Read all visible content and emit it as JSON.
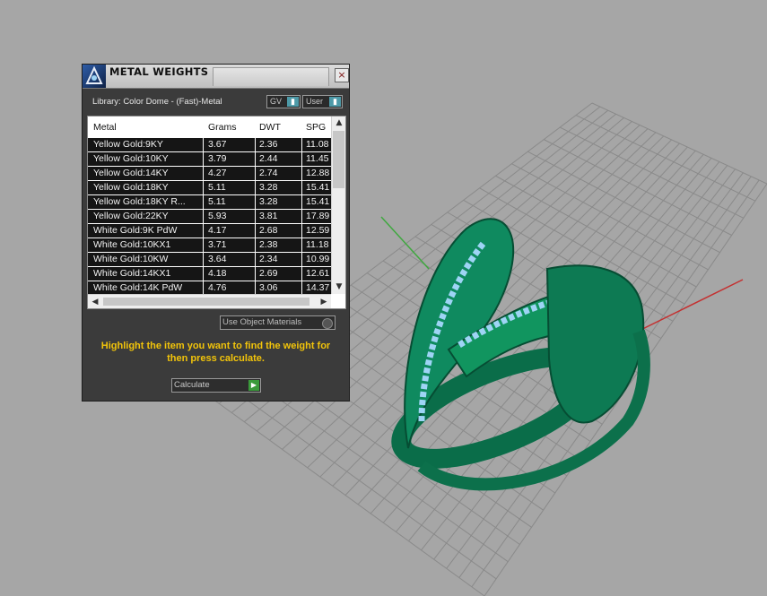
{
  "colors": {
    "accent_yellow": "#f2c40a",
    "panel_bg": "#3b3b3b",
    "ring_green": "#0f8a5f",
    "gem_blue": "#9ed4f5",
    "viewport_bg": "#a6a6a6"
  },
  "panel": {
    "title": "METAL WEIGHTS",
    "close_label": "×",
    "library_label": "Library: Color Dome - (Fast)-Metal",
    "gv_select": "GV",
    "user_select": "User",
    "use_object_materials": "Use Object Materials",
    "instruction": "Highlight the item you want to find the weight for then press calculate.",
    "calculate_label": "Calculate"
  },
  "table": {
    "headers": [
      "Metal",
      "Grams",
      "DWT",
      "SPG"
    ],
    "rows": [
      [
        "Yellow Gold:9KY",
        "3.67",
        "2.36",
        "11.08"
      ],
      [
        "Yellow Gold:10KY",
        "3.79",
        "2.44",
        "11.45"
      ],
      [
        "Yellow Gold:14KY",
        "4.27",
        "2.74",
        "12.88"
      ],
      [
        "Yellow Gold:18KY",
        "5.11",
        "3.28",
        "15.41"
      ],
      [
        "Yellow Gold:18KY R...",
        "5.11",
        "3.28",
        "15.41"
      ],
      [
        "Yellow Gold:22KY",
        "5.93",
        "3.81",
        "17.89"
      ],
      [
        "White Gold:9K PdW",
        "4.17",
        "2.68",
        "12.59"
      ],
      [
        "White Gold:10KX1",
        "3.71",
        "2.38",
        "11.18"
      ],
      [
        "White Gold:10KW",
        "3.64",
        "2.34",
        "10.99"
      ],
      [
        "White Gold:14KX1",
        "4.18",
        "2.69",
        "12.61"
      ],
      [
        "White Gold:14K PdW",
        "4.76",
        "3.06",
        "14.37"
      ]
    ]
  },
  "icons": {
    "logo": "app-logo-icon",
    "up": "scroll-up-icon",
    "down": "scroll-down-icon",
    "left": "scroll-left-icon",
    "right": "scroll-right-icon",
    "go": "play-icon"
  }
}
